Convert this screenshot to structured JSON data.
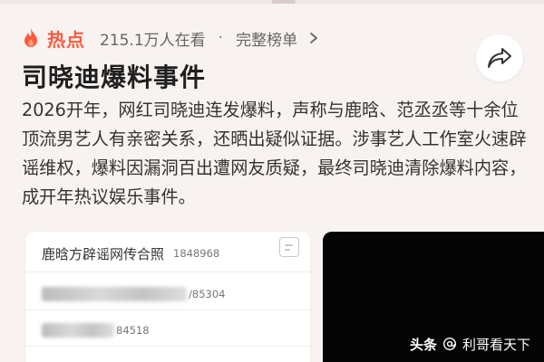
{
  "trending": {
    "label": "热点",
    "viewers": "215.1万人在看",
    "separator": "·",
    "full_list_link": "完整榜单",
    "accent_color": "#ff5a3c"
  },
  "share": {
    "icon": "share-arrow-icon"
  },
  "article": {
    "title": "司晓迪爆料事件",
    "description": "2026开年，网红司晓迪连发爆料，声称与鹿晗、范丞丞等十余位顶流男艺人有亲密关系，还晒出疑似证据。涉事艺人工作室火速辟谣维权，爆料因漏洞百出遭网友质疑，最终司晓迪清除爆料内容，成开年热议娱乐事件。"
  },
  "doc_card": {
    "title": "鹿晗方辟谣网传合照",
    "count": "1848968",
    "rows": [
      {
        "code": "/85304"
      },
      {
        "code": "84518"
      }
    ]
  },
  "watermark": {
    "brand": "头条",
    "account": "利哥看天下"
  }
}
